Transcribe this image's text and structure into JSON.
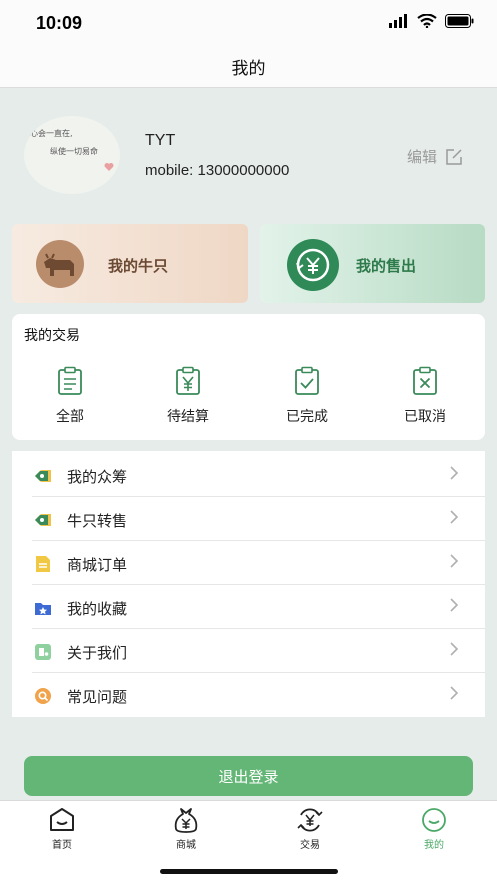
{
  "status_bar": {
    "time": "10:09"
  },
  "header": {
    "title": "我的"
  },
  "profile": {
    "name": "TYT",
    "mobile": "mobile: 13000000000",
    "edit_label": "编辑",
    "avatar_text_1": "心会一直在,",
    "avatar_text_2": "纵使一切易命"
  },
  "cards": {
    "cattle_label": "我的牛只",
    "sale_label": "我的售出"
  },
  "transactions": {
    "title": "我的交易",
    "items": [
      {
        "label": "全部",
        "icon": "clipboard-list-icon"
      },
      {
        "label": "待结算",
        "icon": "clipboard-yen-icon"
      },
      {
        "label": "已完成",
        "icon": "clipboard-check-icon"
      },
      {
        "label": "已取消",
        "icon": "clipboard-x-icon"
      }
    ]
  },
  "menu": {
    "items": [
      {
        "label": "我的众筹",
        "icon": "crowdfund-icon"
      },
      {
        "label": "牛只转售",
        "icon": "resale-icon"
      },
      {
        "label": "商城订单",
        "icon": "order-doc-icon"
      },
      {
        "label": "我的收藏",
        "icon": "favorite-folder-icon"
      },
      {
        "label": "关于我们",
        "icon": "about-icon"
      },
      {
        "label": "常见问题",
        "icon": "faq-icon"
      }
    ]
  },
  "logout_label": "退出登录",
  "tabbar": {
    "items": [
      {
        "label": "首页",
        "icon": "home-icon"
      },
      {
        "label": "商城",
        "icon": "mall-icon"
      },
      {
        "label": "交易",
        "icon": "exchange-icon"
      },
      {
        "label": "我的",
        "icon": "profile-icon"
      }
    ],
    "active_index": 3
  },
  "colors": {
    "accent": "#64b677",
    "accent_dark": "#2f8a57",
    "background": "#e6ecea",
    "tab_active": "#4aa866"
  }
}
